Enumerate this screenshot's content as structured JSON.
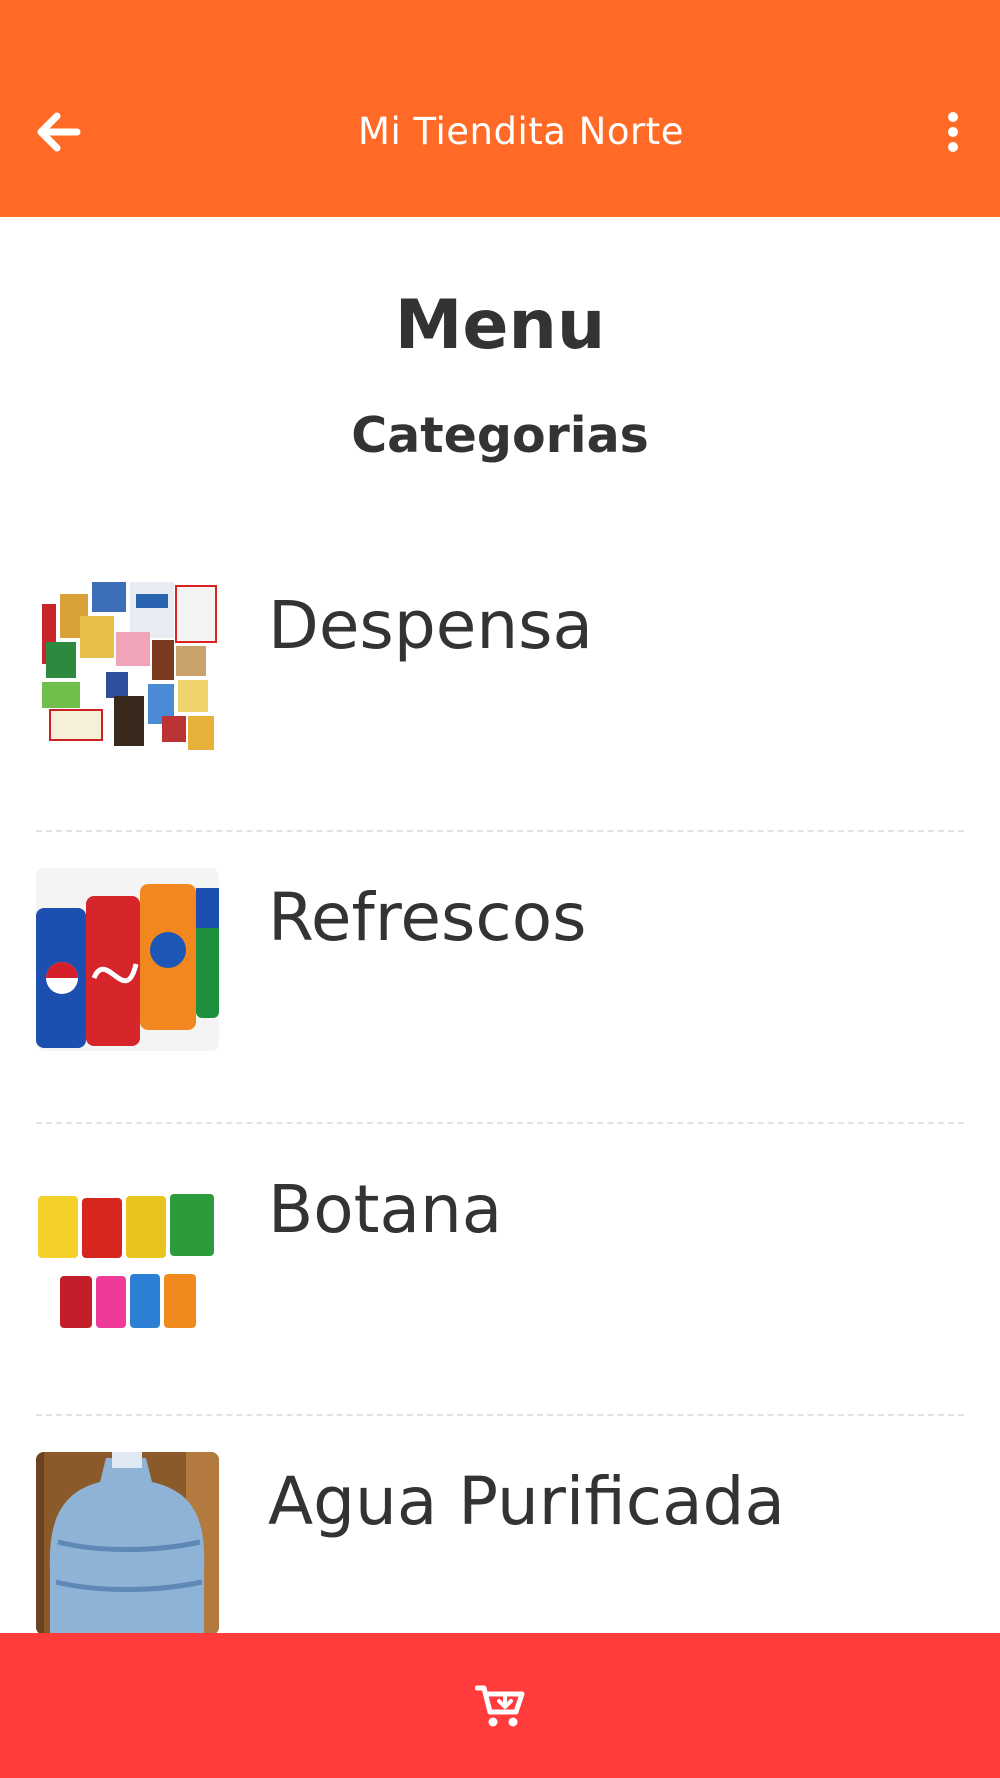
{
  "header": {
    "title": "Mi Tiendita Norte",
    "back_icon": "arrow-left-icon",
    "menu_icon": "more-vertical-icon",
    "background_color": "#ff6b26"
  },
  "main": {
    "heading": "Menu",
    "subheading": "Categorias",
    "categories": [
      {
        "label": "Despensa",
        "image": "groceries-photo"
      },
      {
        "label": "Refrescos",
        "image": "soda-cans-photo"
      },
      {
        "label": "Botana",
        "image": "chip-bags-photo"
      },
      {
        "label": "Agua Purificada",
        "image": "water-jug-photo"
      }
    ]
  },
  "footer": {
    "cart_icon": "cart-add-icon",
    "background_color": "#ff3b3b"
  }
}
